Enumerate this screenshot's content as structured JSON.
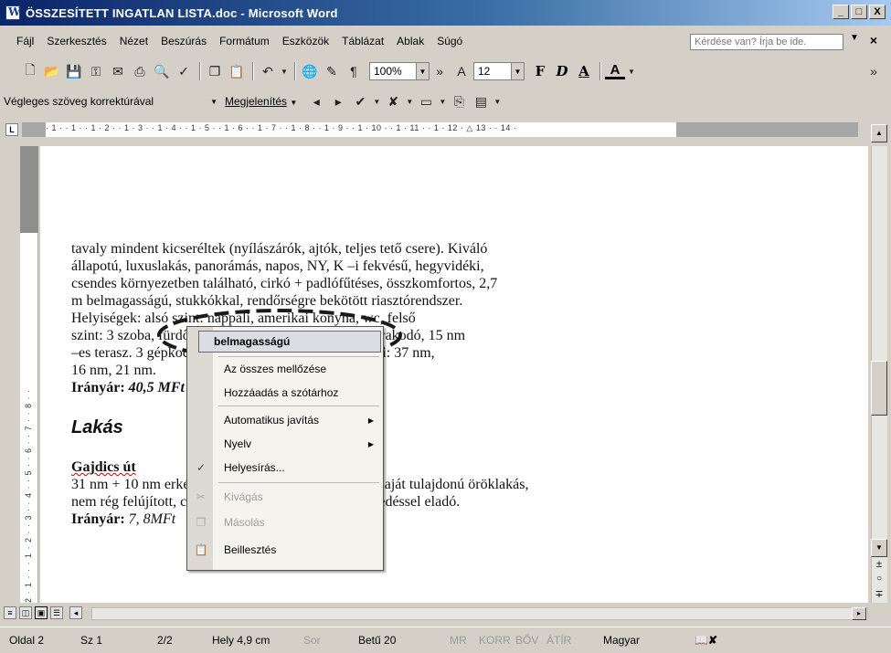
{
  "window": {
    "title": "ÖSSZESÍTETT INGATLAN LISTA.doc - Microsoft Word",
    "minimize": "_",
    "maximize": "□",
    "close": "X"
  },
  "menu": {
    "items": [
      "Fájl",
      "Szerkesztés",
      "Nézet",
      "Beszúrás",
      "Formátum",
      "Eszközök",
      "Táblázat",
      "Ablak",
      "Súgó"
    ],
    "ask_placeholder": "Kérdése van? Írja be ide.",
    "close": "×",
    "more": "»"
  },
  "toolbar": {
    "zoom": "100%",
    "font_size": "12",
    "bold": "F",
    "italic": "D",
    "underline": "A",
    "font_color": "A",
    "more": "»"
  },
  "review_toolbar": {
    "display_mode": "Végleges szöveg korrektúrával",
    "show_menu": "Megjelenítés"
  },
  "ruler": {
    "corner": "L",
    "marks": "· 1 · · 1 · · 1 · 2 · · 1 · 3 · · 1 · 4 · · 1 · 5 · · 1 · 6 · · 1 · 7 · · 1 · 8 · · 1 · 9 · · 1 · 10 · · 1 · 11 · · 1 · 12 · △ 13 · · 14 ·",
    "vertical_marks": "2 · 1 · · · 1 · 2 · · 3 · · 4 · · 5 · · 6 · · 7 · · 8 · ·"
  },
  "document": {
    "lines": [
      "tavaly mindent kicseréltek (nyílászárók, ajtók, teljes tető csere). Kiváló",
      "állapotú, luxuslakás, panorámás, napos, NY, K –i fekvésű, hegyvidéki,",
      "csendes környezetben található, cirkó + padlófűtéses, összkomfortos, 2,7",
      "m belmagasságú, stukkókkal, rendőrségre bekötött riasztórendszer.",
      "Helyiségek: alsó szint: nappali, amerikai konyha, wc, felső",
      "szint: 3 szoba, fürdőszoba, emeleti szoba+wc, padlásrakodó, 15 nm",
      "–es terasz. 3 gépkocsi beálló (21 nm). Szobák méretei: 37 nm,",
      "16 nm, 21 nm."
    ],
    "price1_label": "Irányár: ",
    "price1_value": "40,5 MFt",
    "heading": "Lakás",
    "street": "Gajdics út",
    "lines2": [
      "31 nm + 10 nm erkélyes, 1,5 szobás, bérleménynek, saját tulajdonú öröklakás,",
      "nem rég felújított, csendes házban, nagyon jó közlekedéssel eladó."
    ],
    "price2_label": "Irányár: ",
    "price2_value": "7, 8MFt"
  },
  "context_menu": {
    "suggestion": "belmagasságú",
    "ignore_all": "Az összes mellőzése",
    "add_to_dict": "Hozzáadás a szótárhoz",
    "autocorrect": "Automatikus javítás",
    "language": "Nyelv",
    "spelling": "Helyesírás...",
    "cut": "Kivágás",
    "copy": "Másolás",
    "paste": "Beillesztés"
  },
  "status": {
    "page": "Oldal 2",
    "section": "Sz 1",
    "page_of": "2/2",
    "position": "Hely 4,9 cm",
    "line": "Sor",
    "column": "Betű 20",
    "rec": "MR",
    "trk": "KORR",
    "ext": "BŐV",
    "ovr": "ÁTÍR",
    "language": "Magyar"
  }
}
